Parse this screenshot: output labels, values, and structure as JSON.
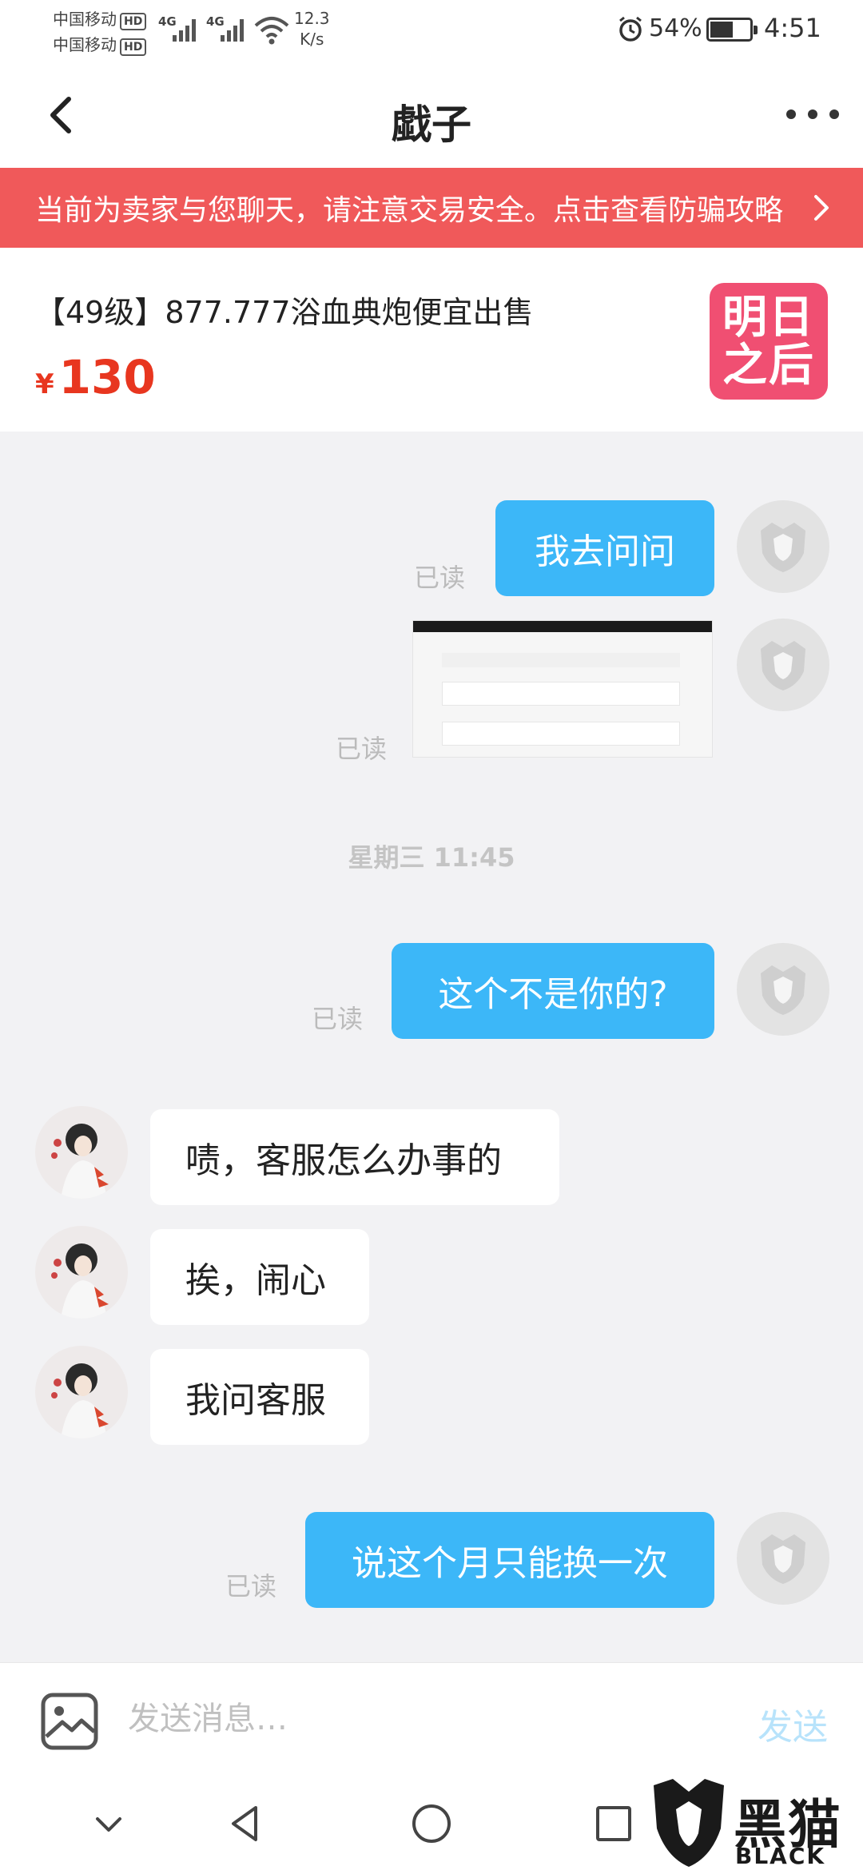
{
  "status_bar": {
    "carrier_1": "中国移动",
    "carrier_2": "中国移动",
    "hd_badge": "HD",
    "network_1": "4G",
    "network_2": "4G",
    "speed_value": "12.3",
    "speed_unit": "K/s",
    "battery_percent": "54%",
    "battery_level": 0.54,
    "time": "4:51",
    "icons": [
      "signal-icon",
      "wifi-icon",
      "alarm-icon",
      "battery-icon"
    ]
  },
  "header": {
    "title": "戱子",
    "back_icon": "chevron-left-icon",
    "more_icon": "more-dots-icon"
  },
  "warning_banner": {
    "text": "当前为卖家与您聊天，请注意交易安全。点击查看防骗攻略",
    "color": "#f0595a"
  },
  "product": {
    "title": "【49级】877.777浴血典炮便宜出售",
    "currency": "¥",
    "price": "130",
    "thumb_line_1": "明日",
    "thumb_line_2": "之后",
    "price_color": "#e8361f"
  },
  "chat": {
    "read_label": "已读",
    "messages": [
      {
        "sender": "self",
        "type": "text",
        "text": "我去问问",
        "read": "已读"
      },
      {
        "sender": "self",
        "type": "image",
        "read": "已读"
      },
      {
        "type": "timestamp",
        "text": "星期三 11:45"
      },
      {
        "sender": "self",
        "type": "text",
        "text": "这个不是你的?",
        "read": "已读"
      },
      {
        "sender": "peer",
        "type": "text",
        "text": "啧，客服怎么办事的"
      },
      {
        "sender": "peer",
        "type": "text",
        "text": "挨，闹心"
      },
      {
        "sender": "peer",
        "type": "text",
        "text": "我问客服"
      },
      {
        "sender": "self",
        "type": "text",
        "text": "说这个月只能换一次",
        "read": "已读"
      }
    ],
    "bubble_color_out": "#3cb7f8"
  },
  "input_bar": {
    "placeholder": "发送消息…",
    "send_label": "发送",
    "image_icon": "image-picker-icon"
  },
  "nav_bar": {
    "icons": [
      "chevron-down-icon",
      "back-triangle-icon",
      "home-circle-icon",
      "recents-square-icon"
    ]
  },
  "watermark": {
    "zh": "黑猫",
    "en": "BLACK CAT"
  }
}
